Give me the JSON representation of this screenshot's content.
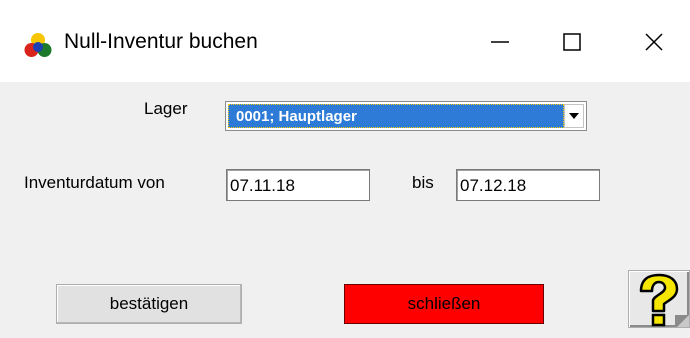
{
  "window": {
    "title": "Null-Inventur buchen",
    "controls": [
      "minimize-icon",
      "maximize-icon",
      "close-icon"
    ]
  },
  "form": {
    "lager_label": "Lager",
    "lager_value": "0001;  Hauptlager",
    "datum_label": "Inventurdatum von",
    "datum_von": "07.11.18",
    "bis_label": "bis",
    "datum_bis": "07.12.18"
  },
  "buttons": {
    "confirm_label": "bestätigen",
    "close_label": "schließen"
  },
  "colors": {
    "selection": "#2d7bd6",
    "close_button": "#ff0000",
    "help_icon": "#f5e600"
  }
}
